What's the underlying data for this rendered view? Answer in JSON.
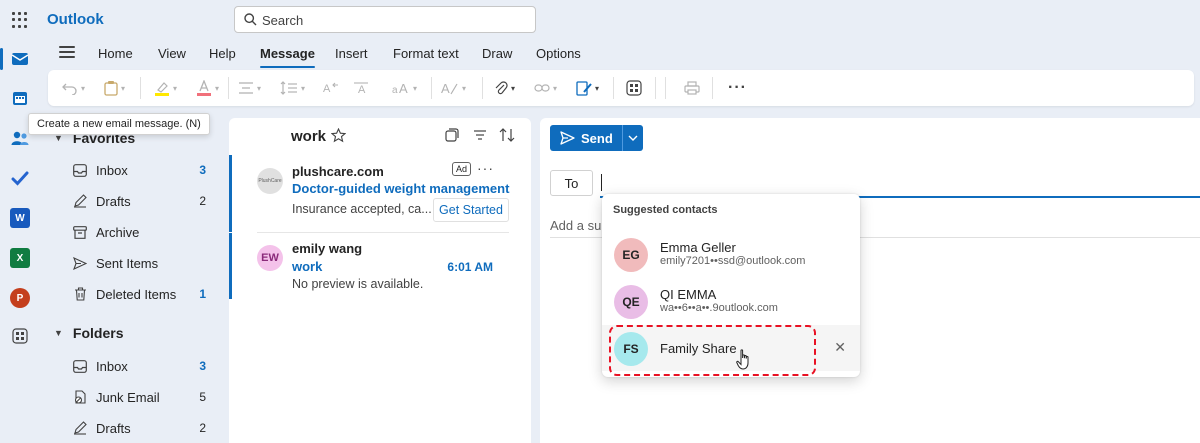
{
  "app": {
    "name": "Outlook"
  },
  "search": {
    "placeholder": "Search"
  },
  "tabs": [
    "Home",
    "View",
    "Help",
    "Message",
    "Insert",
    "Format text",
    "Draw",
    "Options"
  ],
  "tooltip": "Create a new email message. (N)",
  "favorites": {
    "title": "Favorites",
    "items": [
      {
        "label": "Inbox",
        "count": "3",
        "icon": "inbox-icon"
      },
      {
        "label": "Drafts",
        "count": "2",
        "icon": "drafts-icon"
      },
      {
        "label": "Archive",
        "count": "",
        "icon": "archive-icon"
      },
      {
        "label": "Sent Items",
        "count": "",
        "icon": "send-icon"
      },
      {
        "label": "Deleted Items",
        "count": "1",
        "icon": "trash-icon"
      }
    ]
  },
  "folders": {
    "title": "Folders",
    "items": [
      {
        "label": "Inbox",
        "count": "3",
        "icon": "inbox-icon"
      },
      {
        "label": "Junk Email",
        "count": "5",
        "icon": "junk-icon"
      },
      {
        "label": "Drafts",
        "count": "2",
        "icon": "drafts-icon"
      }
    ]
  },
  "message_list": {
    "title": "work",
    "messages": [
      {
        "sender": "plushcare.com",
        "subject": "Doctor-guided weight management",
        "preview": "Insurance accepted, ca...",
        "ad_label": "Ad",
        "cta": "Get Started",
        "avatar_text": "PlushCare"
      },
      {
        "sender": "emily wang",
        "subject": "work",
        "preview": "No preview is available.",
        "time": "6:01 AM",
        "initials": "EW"
      }
    ]
  },
  "compose": {
    "send_label": "Send",
    "to_label": "To",
    "subject_placeholder": "Add a subject"
  },
  "suggestions": {
    "title": "Suggested contacts",
    "contacts": [
      {
        "initials": "EG",
        "name": "Emma Geller",
        "email": "emily7201••ssd@outlook.com",
        "color": "#f1bbbc"
      },
      {
        "initials": "QE",
        "name": "QI EMMA",
        "email": "wa••6••a••.9outlook.com",
        "color": "#e9bde6"
      },
      {
        "initials": "FS",
        "name": "Family Share",
        "email": "",
        "color": "#a6e9ed"
      }
    ]
  },
  "colors": {
    "accent": "#0f6cbd",
    "highlight": "#e81123"
  }
}
